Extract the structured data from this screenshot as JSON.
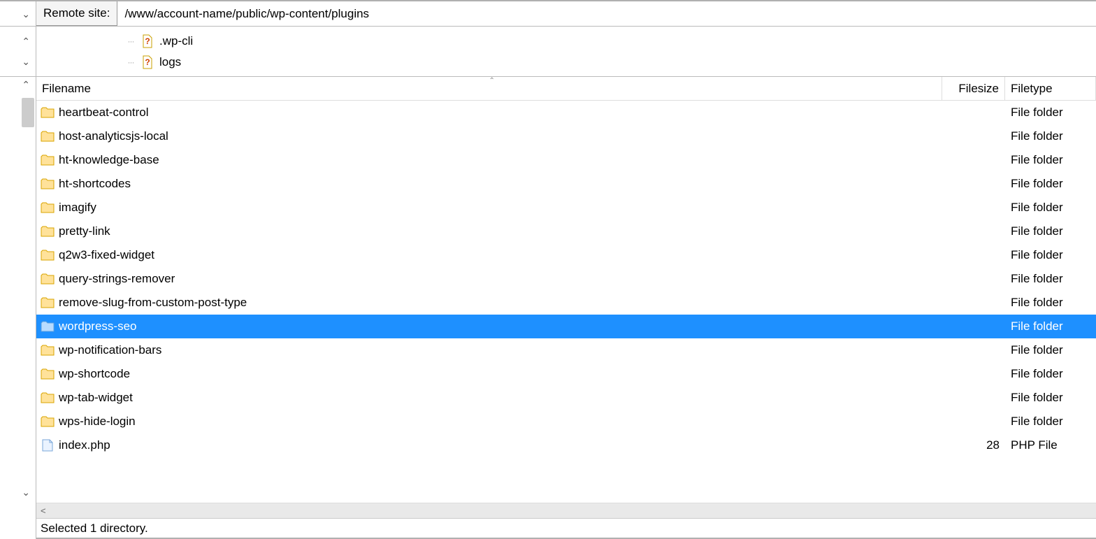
{
  "remote": {
    "label": "Remote site:",
    "path": "/www/account-name/public/wp-content/plugins"
  },
  "tree": {
    "items": [
      {
        "name": ".wp-cli"
      },
      {
        "name": "logs"
      }
    ]
  },
  "columns": {
    "name": "Filename",
    "size": "Filesize",
    "type": "Filetype"
  },
  "files": [
    {
      "name": "heartbeat-control",
      "size": "",
      "type": "File folder",
      "kind": "folder",
      "selected": false
    },
    {
      "name": "host-analyticsjs-local",
      "size": "",
      "type": "File folder",
      "kind": "folder",
      "selected": false
    },
    {
      "name": "ht-knowledge-base",
      "size": "",
      "type": "File folder",
      "kind": "folder",
      "selected": false
    },
    {
      "name": "ht-shortcodes",
      "size": "",
      "type": "File folder",
      "kind": "folder",
      "selected": false
    },
    {
      "name": "imagify",
      "size": "",
      "type": "File folder",
      "kind": "folder",
      "selected": false
    },
    {
      "name": "pretty-link",
      "size": "",
      "type": "File folder",
      "kind": "folder",
      "selected": false
    },
    {
      "name": "q2w3-fixed-widget",
      "size": "",
      "type": "File folder",
      "kind": "folder",
      "selected": false
    },
    {
      "name": "query-strings-remover",
      "size": "",
      "type": "File folder",
      "kind": "folder",
      "selected": false
    },
    {
      "name": "remove-slug-from-custom-post-type",
      "size": "",
      "type": "File folder",
      "kind": "folder",
      "selected": false
    },
    {
      "name": "wordpress-seo",
      "size": "",
      "type": "File folder",
      "kind": "folder",
      "selected": true
    },
    {
      "name": "wp-notification-bars",
      "size": "",
      "type": "File folder",
      "kind": "folder",
      "selected": false
    },
    {
      "name": "wp-shortcode",
      "size": "",
      "type": "File folder",
      "kind": "folder",
      "selected": false
    },
    {
      "name": "wp-tab-widget",
      "size": "",
      "type": "File folder",
      "kind": "folder",
      "selected": false
    },
    {
      "name": "wps-hide-login",
      "size": "",
      "type": "File folder",
      "kind": "folder",
      "selected": false
    },
    {
      "name": "index.php",
      "size": "28",
      "type": "PHP File",
      "kind": "php",
      "selected": false
    }
  ],
  "status": "Selected 1 directory.",
  "hscroll_left": "<"
}
